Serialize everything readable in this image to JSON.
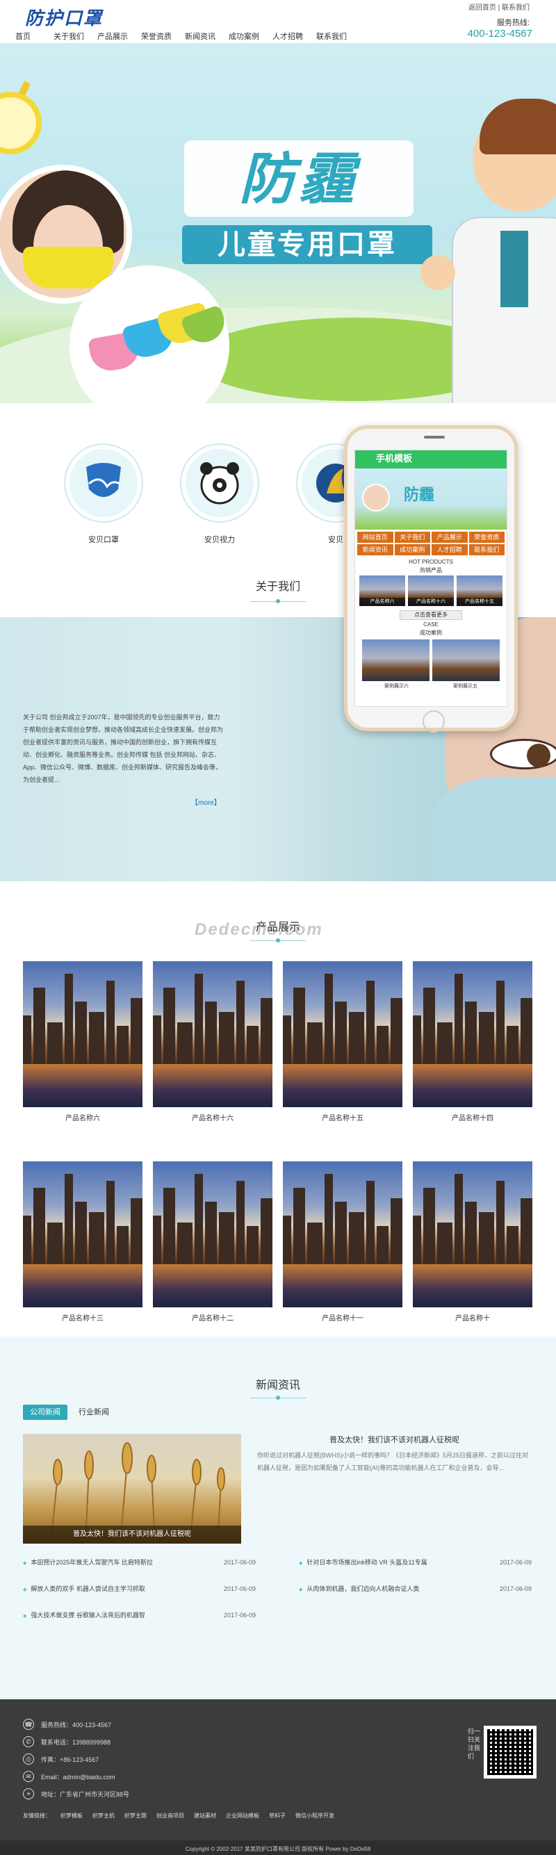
{
  "header": {
    "logo": "防护口罩",
    "toplinks": [
      "返回首页",
      "联系我们"
    ],
    "hotline_label": "服务热线:",
    "hotline": "400-123-4567"
  },
  "nav": [
    "首页",
    "关于我们",
    "产品展示",
    "荣誉资质",
    "新闻资讯",
    "成功案例",
    "人才招聘",
    "联系我们"
  ],
  "banner": {
    "title": "防霾",
    "subtitle": "儿童专用口罩",
    "slides": 3
  },
  "features": [
    {
      "label": "安贝口罩",
      "icon": "shield-icon",
      "color": "#2a6fc2"
    },
    {
      "label": "安贝视力",
      "icon": "panda-icon",
      "color": "#222222"
    },
    {
      "label": "安贝",
      "icon": "sail-icon",
      "color": "#e6b72a"
    }
  ],
  "about": {
    "title": "关于我们",
    "text": "关于公司 创业邦成立于2007年，是中国领先的专业创业服务平台，致力于帮助创业者实现创业梦想，推动各领域高成长企业快速发展。创业邦为创业者提供丰富的资讯与服务，推动中国的创新创业，旗下拥有传媒互动、创业孵化、融资服务等业务。创业邦传媒 包括 创业邦网站、杂志、App、微信公众号、微博、数据库、创业邦新媒体、研究报告及峰会等，为创业者提...",
    "more": "【more】"
  },
  "phone": {
    "title": "手机模板",
    "banner_title": "防霾",
    "nav": [
      "网站首页",
      "关于我们",
      "产品展示",
      "荣誉资质",
      "新闻资讯",
      "成功案例",
      "人才招聘",
      "联系我们"
    ],
    "hot_label": "HOT PRODUCTS",
    "hot_title": "热销产品",
    "products": [
      "产品名称六",
      "产品名称十六",
      "产品名称十五"
    ],
    "more_btn": "点击查看更多",
    "case_label": "CASE",
    "case_title": "成功案例",
    "cases": [
      "案例展示六",
      "案例展示五"
    ]
  },
  "products": {
    "title": "产品展示",
    "watermark": "Dedecms.com",
    "items": [
      "产品名称六",
      "产品名称十六",
      "产品名称十五",
      "产品名称十四",
      "产品名称十三",
      "产品名称十二",
      "产品名称十一",
      "产品名称十"
    ]
  },
  "news": {
    "title": "新闻资讯",
    "tabs": [
      "公司新闻",
      "行业新闻"
    ],
    "feature_caption": "普及太快！我们该不该对机器人征税呢",
    "feature_title": "普及太快！我们该不该对机器人征税呢",
    "feature_body": "你听说过对机器人征税(BWHS)小说一样的事吗？《日本经济新闻》5月25日报道称，之前以过往对机器人征税，是因为如果配备了人工智能(AI)等的高功能机器人在工厂和企业普及，会导...",
    "left_list": [
      {
        "title": "本田预计2025年推无人驾驶汽车 比肩特斯拉",
        "date": "2017-06-09"
      },
      {
        "title": "解放人类的双手 机器人尝试自主学习抓取",
        "date": "2017-06-09"
      },
      {
        "title": "强大技术做支撑 谷歌输入法背后的机器智",
        "date": "2017-06-09"
      }
    ],
    "right_list": [
      {
        "title": "针对日本市场推出ink移动 VR 头盔及11专属",
        "date": "2017-06-09"
      },
      {
        "title": "从肉体到机器，我们迈向人机融合证人类",
        "date": "2017-06-09"
      }
    ]
  },
  "footer": {
    "lines": [
      {
        "icon": "phone-icon",
        "glyph": "☎",
        "text": "服务热线：400-123-4567"
      },
      {
        "icon": "mobile-icon",
        "glyph": "✆",
        "text": "联系电话：13988999988"
      },
      {
        "icon": "fax-icon",
        "glyph": "⎙",
        "text": "传真：+86-123-4567"
      },
      {
        "icon": "email-icon",
        "glyph": "✉",
        "text": "Email：admin@baidu.com"
      },
      {
        "icon": "location-icon",
        "glyph": "⌖",
        "text": "地址：广东省广州市天河区88号"
      }
    ],
    "links_label": "友情链接：",
    "links": [
      "织梦模板",
      "织梦主机",
      "织梦主题",
      "创业商项目",
      "建站素材",
      "企业网站模板",
      "草料子",
      "微信小程序开发"
    ],
    "qr_label": "扫一扫关注我们",
    "copyright": "Copyright © 2002-2017 某某防护口罩有限公司 版权所有 Power by DeDe58"
  }
}
